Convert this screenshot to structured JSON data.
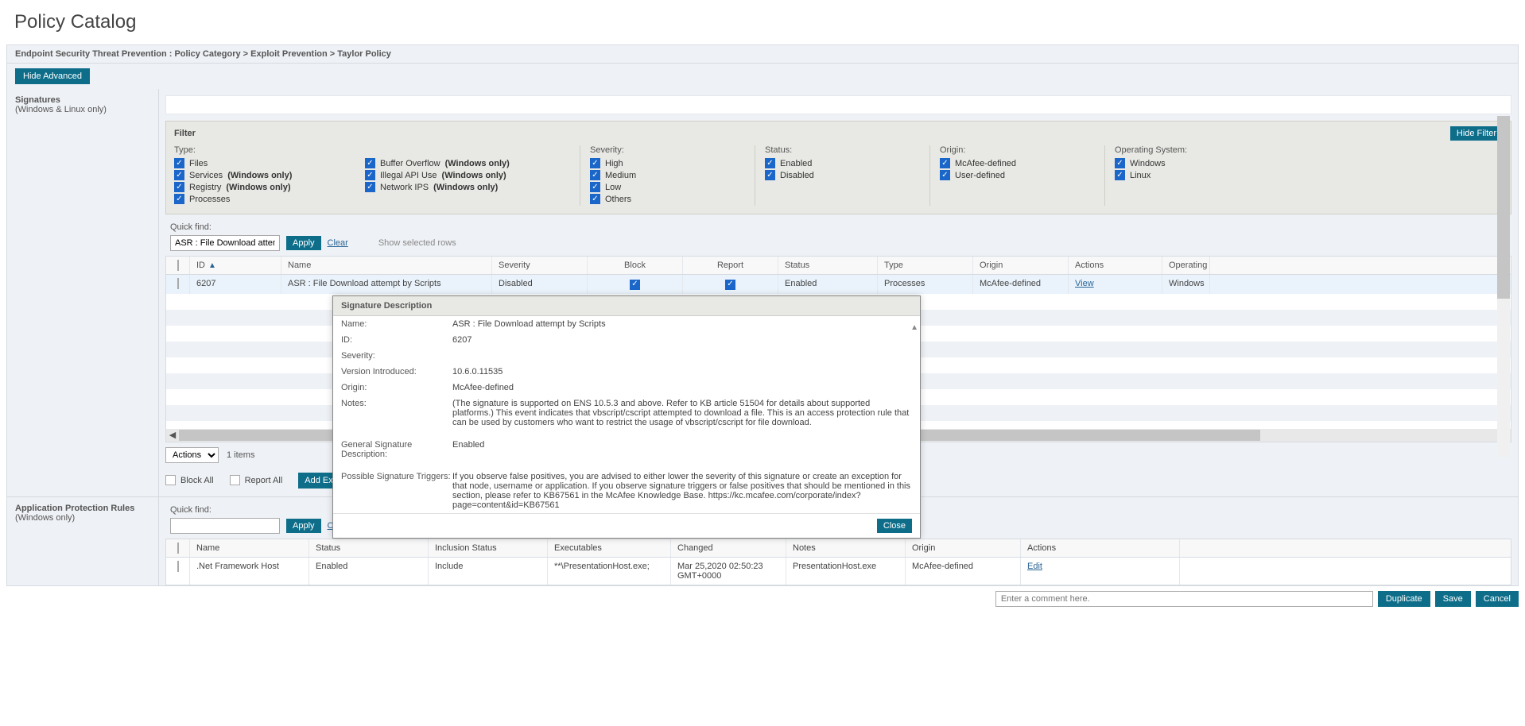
{
  "page": {
    "title": "Policy Catalog",
    "breadcrumb": "Endpoint Security Threat Prevention : Policy Category > Exploit Prevention > Taylor Policy",
    "hide_advanced": "Hide Advanced"
  },
  "sidebar": {
    "signatures": {
      "title": "Signatures",
      "subtitle": "(Windows & Linux only)"
    },
    "apr": {
      "title": "Application Protection Rules",
      "subtitle": "(Windows only)"
    }
  },
  "filter": {
    "title": "Filter",
    "hide_filter": "Hide Filter",
    "type_label": "Type:",
    "type": {
      "files": "Files",
      "services": "Services",
      "services_note": "(Windows only)",
      "registry": "Registry",
      "registry_note": "(Windows only)",
      "processes": "Processes",
      "buffer": "Buffer Overflow",
      "buffer_note": "(Windows only)",
      "illegal": "Illegal API Use",
      "illegal_note": "(Windows only)",
      "nips": "Network IPS",
      "nips_note": "(Windows only)"
    },
    "severity_label": "Severity:",
    "severity": {
      "high": "High",
      "medium": "Medium",
      "low": "Low",
      "others": "Others"
    },
    "status_label": "Status:",
    "status": {
      "enabled": "Enabled",
      "disabled": "Disabled"
    },
    "origin_label": "Origin:",
    "origin": {
      "mcafee": "McAfee-defined",
      "user": "User-defined"
    },
    "os_label": "Operating System:",
    "os": {
      "windows": "Windows",
      "linux": "Linux"
    }
  },
  "quickfind": {
    "label": "Quick find:",
    "value": "ASR : File Download attempt",
    "apply": "Apply",
    "clear": "Clear",
    "show_selected": "Show selected rows"
  },
  "sig_table": {
    "headers": {
      "id": "ID",
      "name": "Name",
      "severity": "Severity",
      "block": "Block",
      "report": "Report",
      "status": "Status",
      "type": "Type",
      "origin": "Origin",
      "actions": "Actions",
      "os": "Operating"
    },
    "row": {
      "id": "6207",
      "name": "ASR : File Download attempt by Scripts",
      "severity": "Disabled",
      "status": "Enabled",
      "type": "Processes",
      "origin": "McAfee-defined",
      "action": "View",
      "os": "Windows"
    }
  },
  "actions_bar": {
    "actions_label": "Actions",
    "items": "1 items",
    "block_all": "Block All",
    "report_all": "Report All",
    "add_expert": "Add Exp"
  },
  "modal": {
    "title": "Signature Description",
    "name_l": "Name:",
    "name_v": "ASR : File Download attempt by Scripts",
    "id_l": "ID:",
    "id_v": "6207",
    "sev_l": "Severity:",
    "ver_l": "Version Introduced:",
    "ver_v": "10.6.0.11535",
    "origin_l": "Origin:",
    "origin_v": "McAfee-defined",
    "notes_l": "Notes:",
    "notes_v": "(The signature is supported on ENS 10.5.3 and above. Refer to KB article 51504 for details about supported platforms.) This event indicates that vbscript/cscript attempted to download a file. This is an access protection rule that can be used by customers who want to restrict the usage of vbscript/cscript for file download.",
    "gsd_l": "General Signature Description:",
    "gsd_v": "Enabled",
    "pst_l": "Possible Signature Triggers:",
    "pst_v": "If you observe false positives, you are advised to either lower the severity of this signature or create an exception for that node, username or application. If you observe signature triggers or false positives that should be mentioned in this section, please refer to KB67561 in the McAfee Knowledge Base. https://kc.mcafee.com/corporate/index?page=content&id=KB67561",
    "close": "Close"
  },
  "quickfind2": {
    "label": "Quick find:",
    "apply": "Apply",
    "clear": "Clear"
  },
  "apr_table": {
    "headers": {
      "name": "Name",
      "status": "Status",
      "incl": "Inclusion Status",
      "exec": "Executables",
      "changed": "Changed",
      "notes": "Notes",
      "origin": "Origin",
      "actions": "Actions"
    },
    "row": {
      "name": ".Net Framework Host",
      "status": "Enabled",
      "incl": "Include",
      "exec": "**\\PresentationHost.exe;",
      "changed": "Mar 25,2020 02:50:23 GMT+0000",
      "notes": "PresentationHost.exe",
      "origin": "McAfee-defined",
      "action": "Edit"
    }
  },
  "footer": {
    "comment_placeholder": "Enter a comment here.",
    "duplicate": "Duplicate",
    "save": "Save",
    "cancel": "Cancel"
  }
}
